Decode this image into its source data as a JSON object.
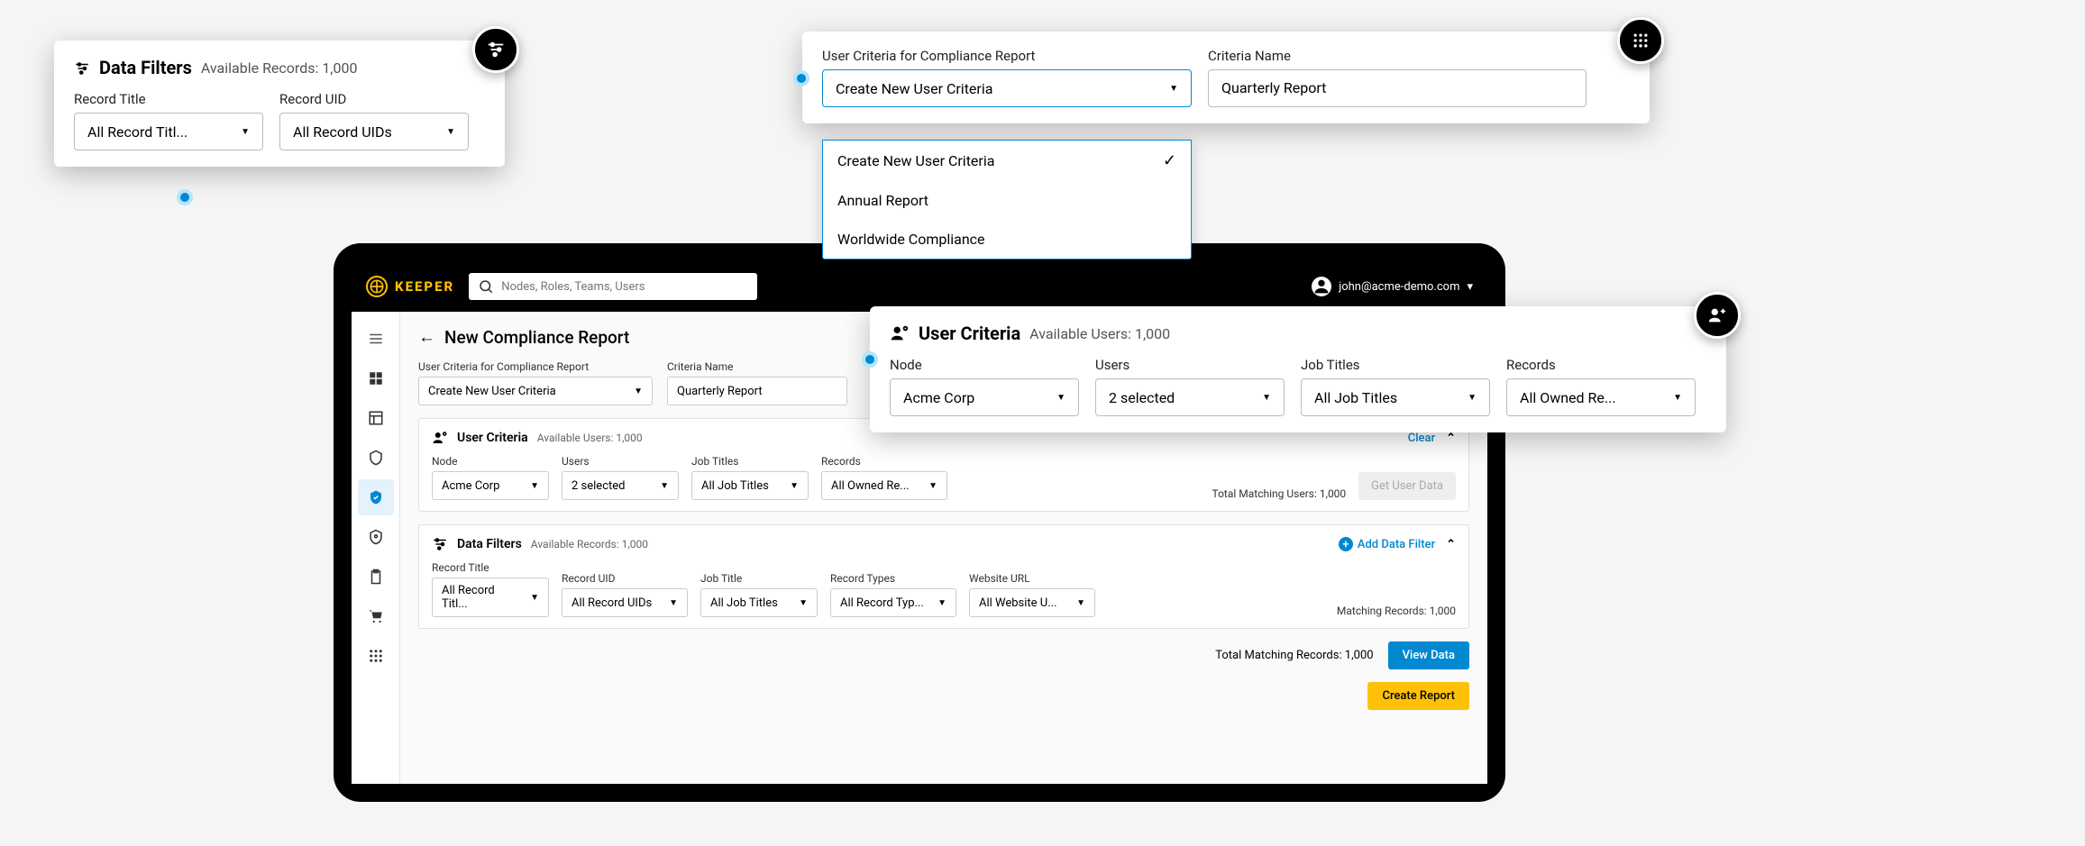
{
  "app": {
    "brand": "KEEPER",
    "search_placeholder": "Nodes, Roles, Teams, Users",
    "user_email": "john@acme-demo.com"
  },
  "page": {
    "title": "New Compliance Report",
    "criteria_label": "User Criteria for Compliance Report",
    "criteria_value": "Create New User Criteria",
    "criteria_name_label": "Criteria Name",
    "criteria_name_value": "Quarterly Report"
  },
  "user_criteria": {
    "heading": "User Criteria",
    "available": "Available Users: 1,000",
    "clear": "Clear",
    "fields": {
      "node_label": "Node",
      "node_value": "Acme Corp",
      "users_label": "Users",
      "users_value": "2 selected",
      "job_label": "Job Titles",
      "job_value": "All Job Titles",
      "records_label": "Records",
      "records_value": "All Owned Re..."
    },
    "matching": "Total Matching Users: 1,000",
    "get_data": "Get User Data"
  },
  "data_filters": {
    "heading": "Data Filters",
    "available": "Available Records: 1,000",
    "add": "Add Data Filter",
    "fields": {
      "title_label": "Record Title",
      "title_value": "All Record Titl...",
      "uid_label": "Record UID",
      "uid_value": "All Record UIDs",
      "job_label": "Job Title",
      "job_value": "All Job Titles",
      "types_label": "Record Types",
      "types_value": "All Record Typ...",
      "url_label": "Website URL",
      "url_value": "All Website U..."
    },
    "matching": "Matching Records: 1,000",
    "total": "Total Matching Records: 1,000",
    "view_data": "View Data",
    "create": "Create Report"
  },
  "callout_filter": {
    "heading": "Data Filters",
    "available": "Available Records: 1,000",
    "title_label": "Record Title",
    "title_value": "All Record Titl...",
    "uid_label": "Record UID",
    "uid_value": "All Record UIDs"
  },
  "callout_criteria": {
    "criteria_label": "User Criteria for Compliance Report",
    "criteria_value": "Create New User Criteria",
    "name_label": "Criteria Name",
    "name_value": "Quarterly Report",
    "options": [
      "Create New User Criteria",
      "Annual Report",
      "Worldwide Compliance"
    ]
  },
  "callout_user": {
    "heading": "User Criteria",
    "available": "Available Users: 1,000",
    "node_label": "Node",
    "node_value": "Acme Corp",
    "users_label": "Users",
    "users_value": "2 selected",
    "job_label": "Job Titles",
    "job_value": "All Job Titles",
    "records_label": "Records",
    "records_value": "All Owned Re..."
  }
}
